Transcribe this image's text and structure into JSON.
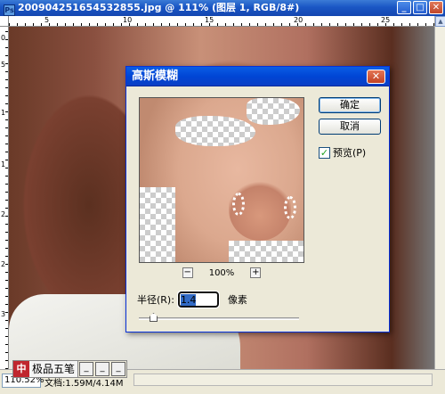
{
  "document": {
    "title": "20090425165453285​5.jpg @ 111% (图层 1, RGB/8#)",
    "zoom": "110.52%",
    "doc_size": "文档:1.59M/4.14M"
  },
  "ruler": {
    "top_numbers": [
      "5",
      "10",
      "15",
      "20",
      "25"
    ],
    "left_numbers": [
      "0",
      "5",
      "1",
      "1",
      "2",
      "2",
      "3"
    ]
  },
  "dialog": {
    "title": "高斯模糊",
    "ok_label": "确定",
    "cancel_label": "取消",
    "preview_label": "预览(P)",
    "preview_checked": true,
    "zoom_minus": "−",
    "zoom_plus": "+",
    "zoom_percent": "100%",
    "radius_label": "半径(R):",
    "radius_value": "1.4",
    "radius_unit": "像素",
    "slider_position": 0.1
  },
  "ime": {
    "logo": "中",
    "label": "极品五笔",
    "buttons": [
      "_",
      "_",
      "_"
    ]
  }
}
